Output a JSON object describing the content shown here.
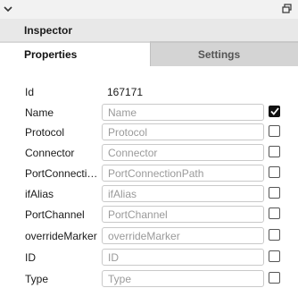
{
  "window": {
    "left_icon": "chevron-down-icon",
    "right_icon": "restore-window-icon"
  },
  "header": {
    "title": "Inspector"
  },
  "tabs": [
    {
      "label": "Properties",
      "active": true
    },
    {
      "label": "Settings",
      "active": false
    }
  ],
  "id_field": {
    "label": "Id",
    "value": "167171"
  },
  "fields": [
    {
      "label": "Name",
      "value": "",
      "placeholder": "Name",
      "checked": true
    },
    {
      "label": "Protocol",
      "value": "",
      "placeholder": "Protocol",
      "checked": false
    },
    {
      "label": "Connector",
      "value": "",
      "placeholder": "Connector",
      "checked": false
    },
    {
      "label": "PortConnectio...",
      "value": "",
      "placeholder": "PortConnectionPath",
      "checked": false
    },
    {
      "label": "ifAlias",
      "value": "",
      "placeholder": "ifAlias",
      "checked": false
    },
    {
      "label": "PortChannel",
      "value": "",
      "placeholder": "PortChannel",
      "checked": false
    },
    {
      "label": "overrideMarker",
      "value": "",
      "placeholder": "overrideMarker",
      "checked": false
    },
    {
      "label": "ID",
      "value": "",
      "placeholder": "ID",
      "checked": false
    },
    {
      "label": "Type",
      "value": "",
      "placeholder": "Type",
      "checked": false
    }
  ],
  "colors": {
    "header_bg": "#e8e8e8",
    "inactive_tab_bg": "#d4d4d4",
    "checkbox_checked": "#111111"
  }
}
